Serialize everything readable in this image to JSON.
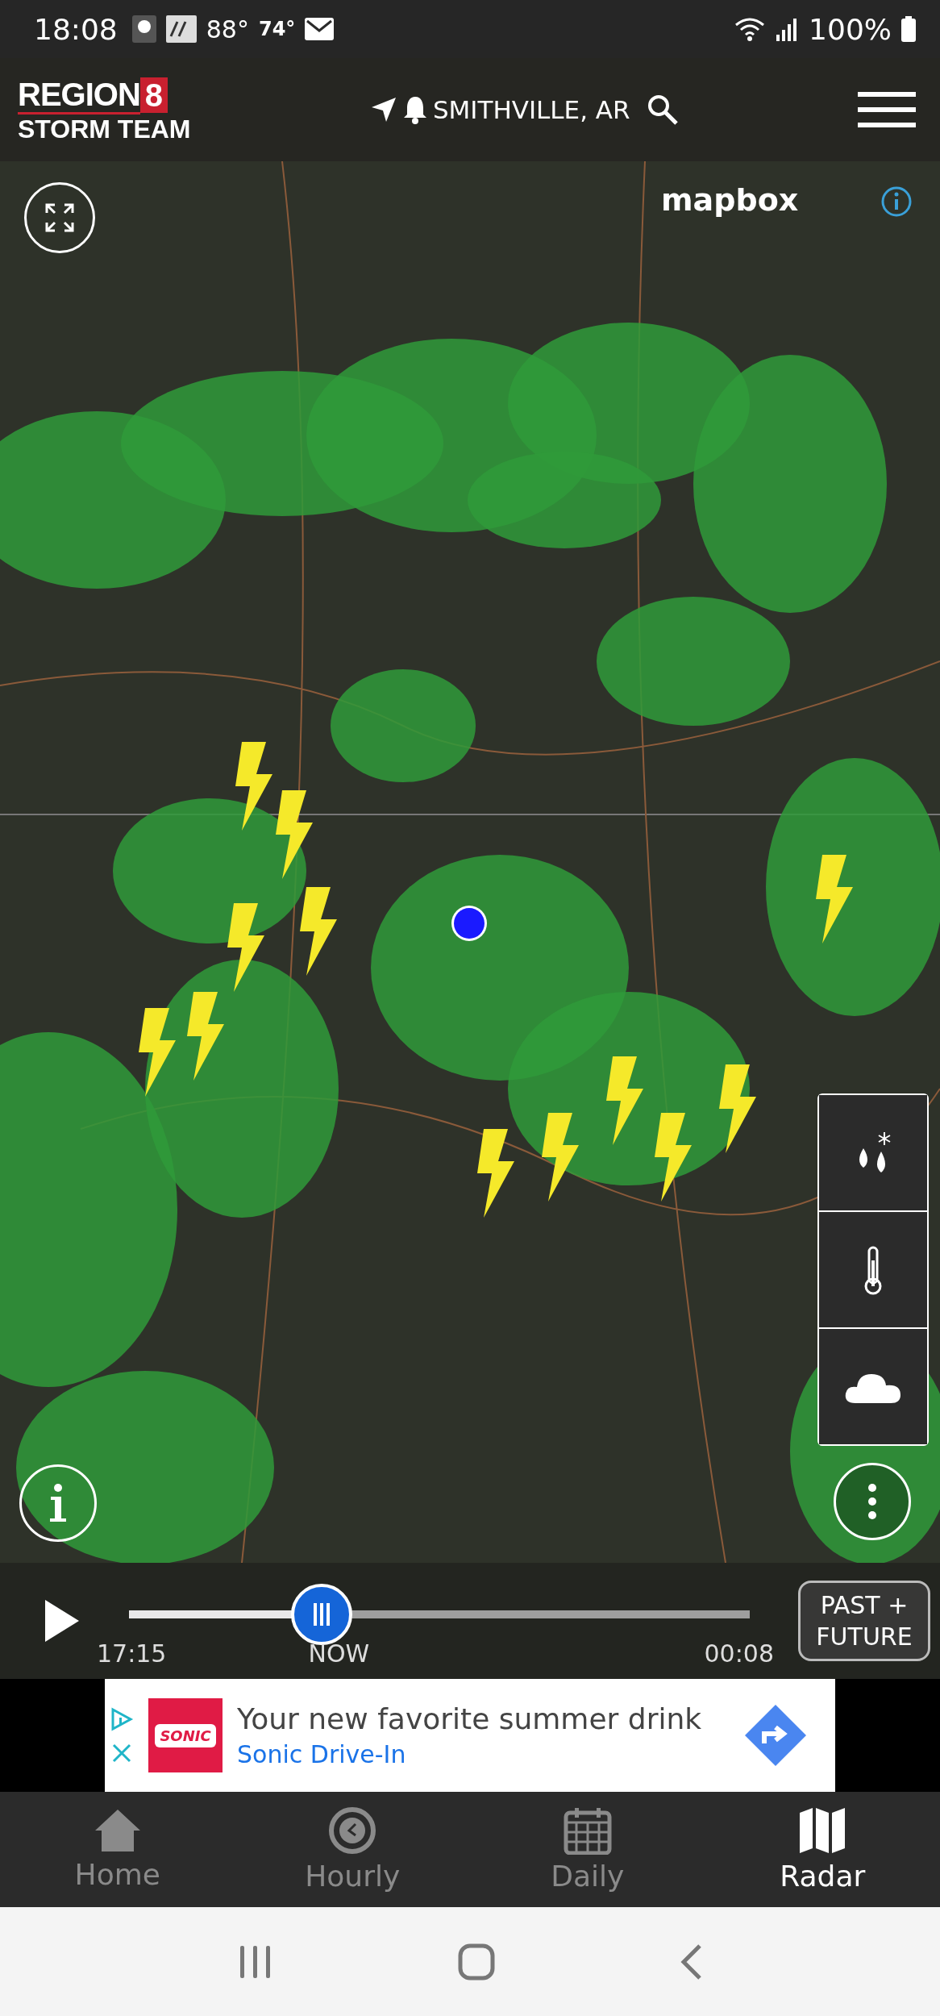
{
  "status_bar": {
    "time": "18:08",
    "temp_high": "88°",
    "temp_low": "74°",
    "battery": "100%"
  },
  "header": {
    "logo": {
      "line1": "REGION",
      "badge": "8",
      "line2": "STORM TEAM"
    },
    "location": "SMITHVILLE, AR"
  },
  "map": {
    "attribution": "mapbox",
    "layers": [
      {
        "kind": "precip"
      },
      {
        "kind": "temperature"
      },
      {
        "kind": "cloud"
      }
    ]
  },
  "timeline": {
    "level": 0.31,
    "start": "17:15",
    "now": "NOW",
    "end": "00:08",
    "mode_button": "PAST + FUTURE"
  },
  "ad": {
    "logo": "SONIC",
    "headline": "Your new favorite summer drink",
    "advertiser": "Sonic Drive-In"
  },
  "tabs": [
    {
      "label": "Home",
      "kind": "home",
      "selected": false
    },
    {
      "label": "Hourly",
      "kind": "hourly",
      "selected": false
    },
    {
      "label": "Daily",
      "kind": "daily",
      "selected": false
    },
    {
      "label": "Radar",
      "kind": "radar",
      "selected": true
    }
  ]
}
